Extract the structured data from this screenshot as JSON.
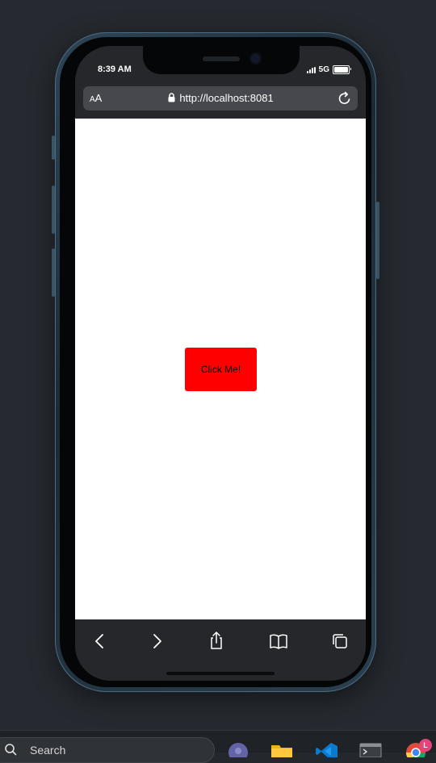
{
  "status_bar": {
    "time": "8:39 AM",
    "network": "5G",
    "battery_level": 1.0
  },
  "browser": {
    "text_size_label_small": "A",
    "text_size_label_large": "A",
    "url": "http://localhost:8081",
    "icons": {
      "lock": "lock-icon",
      "reload": "reload-icon"
    }
  },
  "page": {
    "button_label": "Click Me!",
    "button_color": "#ff0000",
    "background": "#ffffff"
  },
  "toolbar": {
    "icons": [
      "back-icon",
      "forward-icon",
      "share-icon",
      "bookmarks-icon",
      "tabs-icon"
    ]
  },
  "taskbar": {
    "search_placeholder": "Search",
    "apps": [
      "teams-icon",
      "file-explorer-icon",
      "vscode-icon",
      "terminal-icon",
      "chrome-icon"
    ],
    "chrome_badge": "L"
  },
  "colors": {
    "desktop": "#262a30",
    "phone_frame": "#2e4556",
    "address_bar": "#46484d",
    "toolbar": "#25272b"
  }
}
